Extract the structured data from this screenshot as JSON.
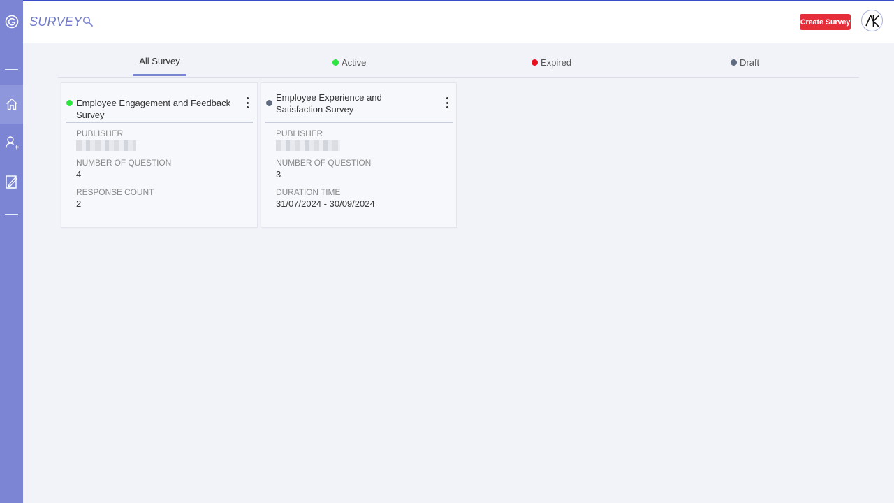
{
  "header": {
    "title": "SURVEY",
    "create_label": "Create Survey",
    "avatar_initials": "AK"
  },
  "sidebar": {
    "items": [
      {
        "icon": "home-icon",
        "active": true
      },
      {
        "icon": "add-user-icon",
        "active": false
      },
      {
        "icon": "edit-document-icon",
        "active": false
      }
    ]
  },
  "tabs": [
    {
      "label": "All Survey",
      "dot_color": null,
      "active": true
    },
    {
      "label": "Active",
      "dot_color": "#2ee43f",
      "active": false
    },
    {
      "label": "Expired",
      "dot_color": "#e8101c",
      "active": false
    },
    {
      "label": "Draft",
      "dot_color": "#5f6c7f",
      "active": false
    }
  ],
  "cards": [
    {
      "title": "Employee Engagement and Feedback Survey",
      "status_color": "#2ee43f",
      "publisher_label": "PUBLISHER",
      "questions_label": "NUMBER OF QUESTION",
      "questions_value": "4",
      "third_label": "RESPONSE COUNT",
      "third_value": "2"
    },
    {
      "title": "Employee Experience and Satisfaction Survey",
      "status_color": "#5f6c7f",
      "publisher_label": "PUBLISHER",
      "questions_label": "NUMBER OF QUESTION",
      "questions_value": "3",
      "third_label": "DURATION TIME",
      "third_value": "31/07/2024 - 30/09/2024"
    }
  ],
  "colors": {
    "sidebar": "#7b85d4",
    "accent": "#7b85d4",
    "primary_button": "#e52e3a"
  }
}
